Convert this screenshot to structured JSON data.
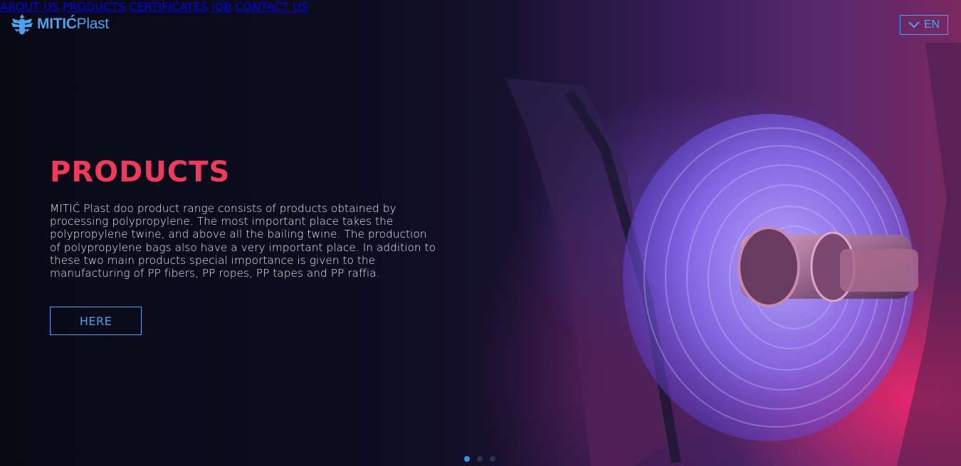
{
  "brand": {
    "name_bold": "MITIĆ",
    "name_rest": "Plast"
  },
  "nav": {
    "items": [
      {
        "label": "ABOUT US"
      },
      {
        "label": "PRODUCTS"
      },
      {
        "label": "CERTIFICATES"
      },
      {
        "label": "JOB"
      },
      {
        "label": "CONTACT US"
      }
    ]
  },
  "language": {
    "label": "EN",
    "icon": "chevron-down-icon"
  },
  "hero": {
    "title": "PRODUCTS",
    "text": "MITIĆ Plast doo product range consists of products obtained by processing polypropylene. The most important place takes the polypropylene twine, and above all the bailing twine. The production of polypropylene bags also have a very important place. In addition to these two main products special importance is given to the manufacturing of PP fibers, PP ropes, PP tapes and PP raffia.",
    "button_label": "HERE"
  },
  "carousel": {
    "slides": 3,
    "active_index": 0
  },
  "colors": {
    "accent_blue": "#4aa3f0",
    "title_red": "#f03a5a",
    "body_text": "#e8e8f0"
  }
}
